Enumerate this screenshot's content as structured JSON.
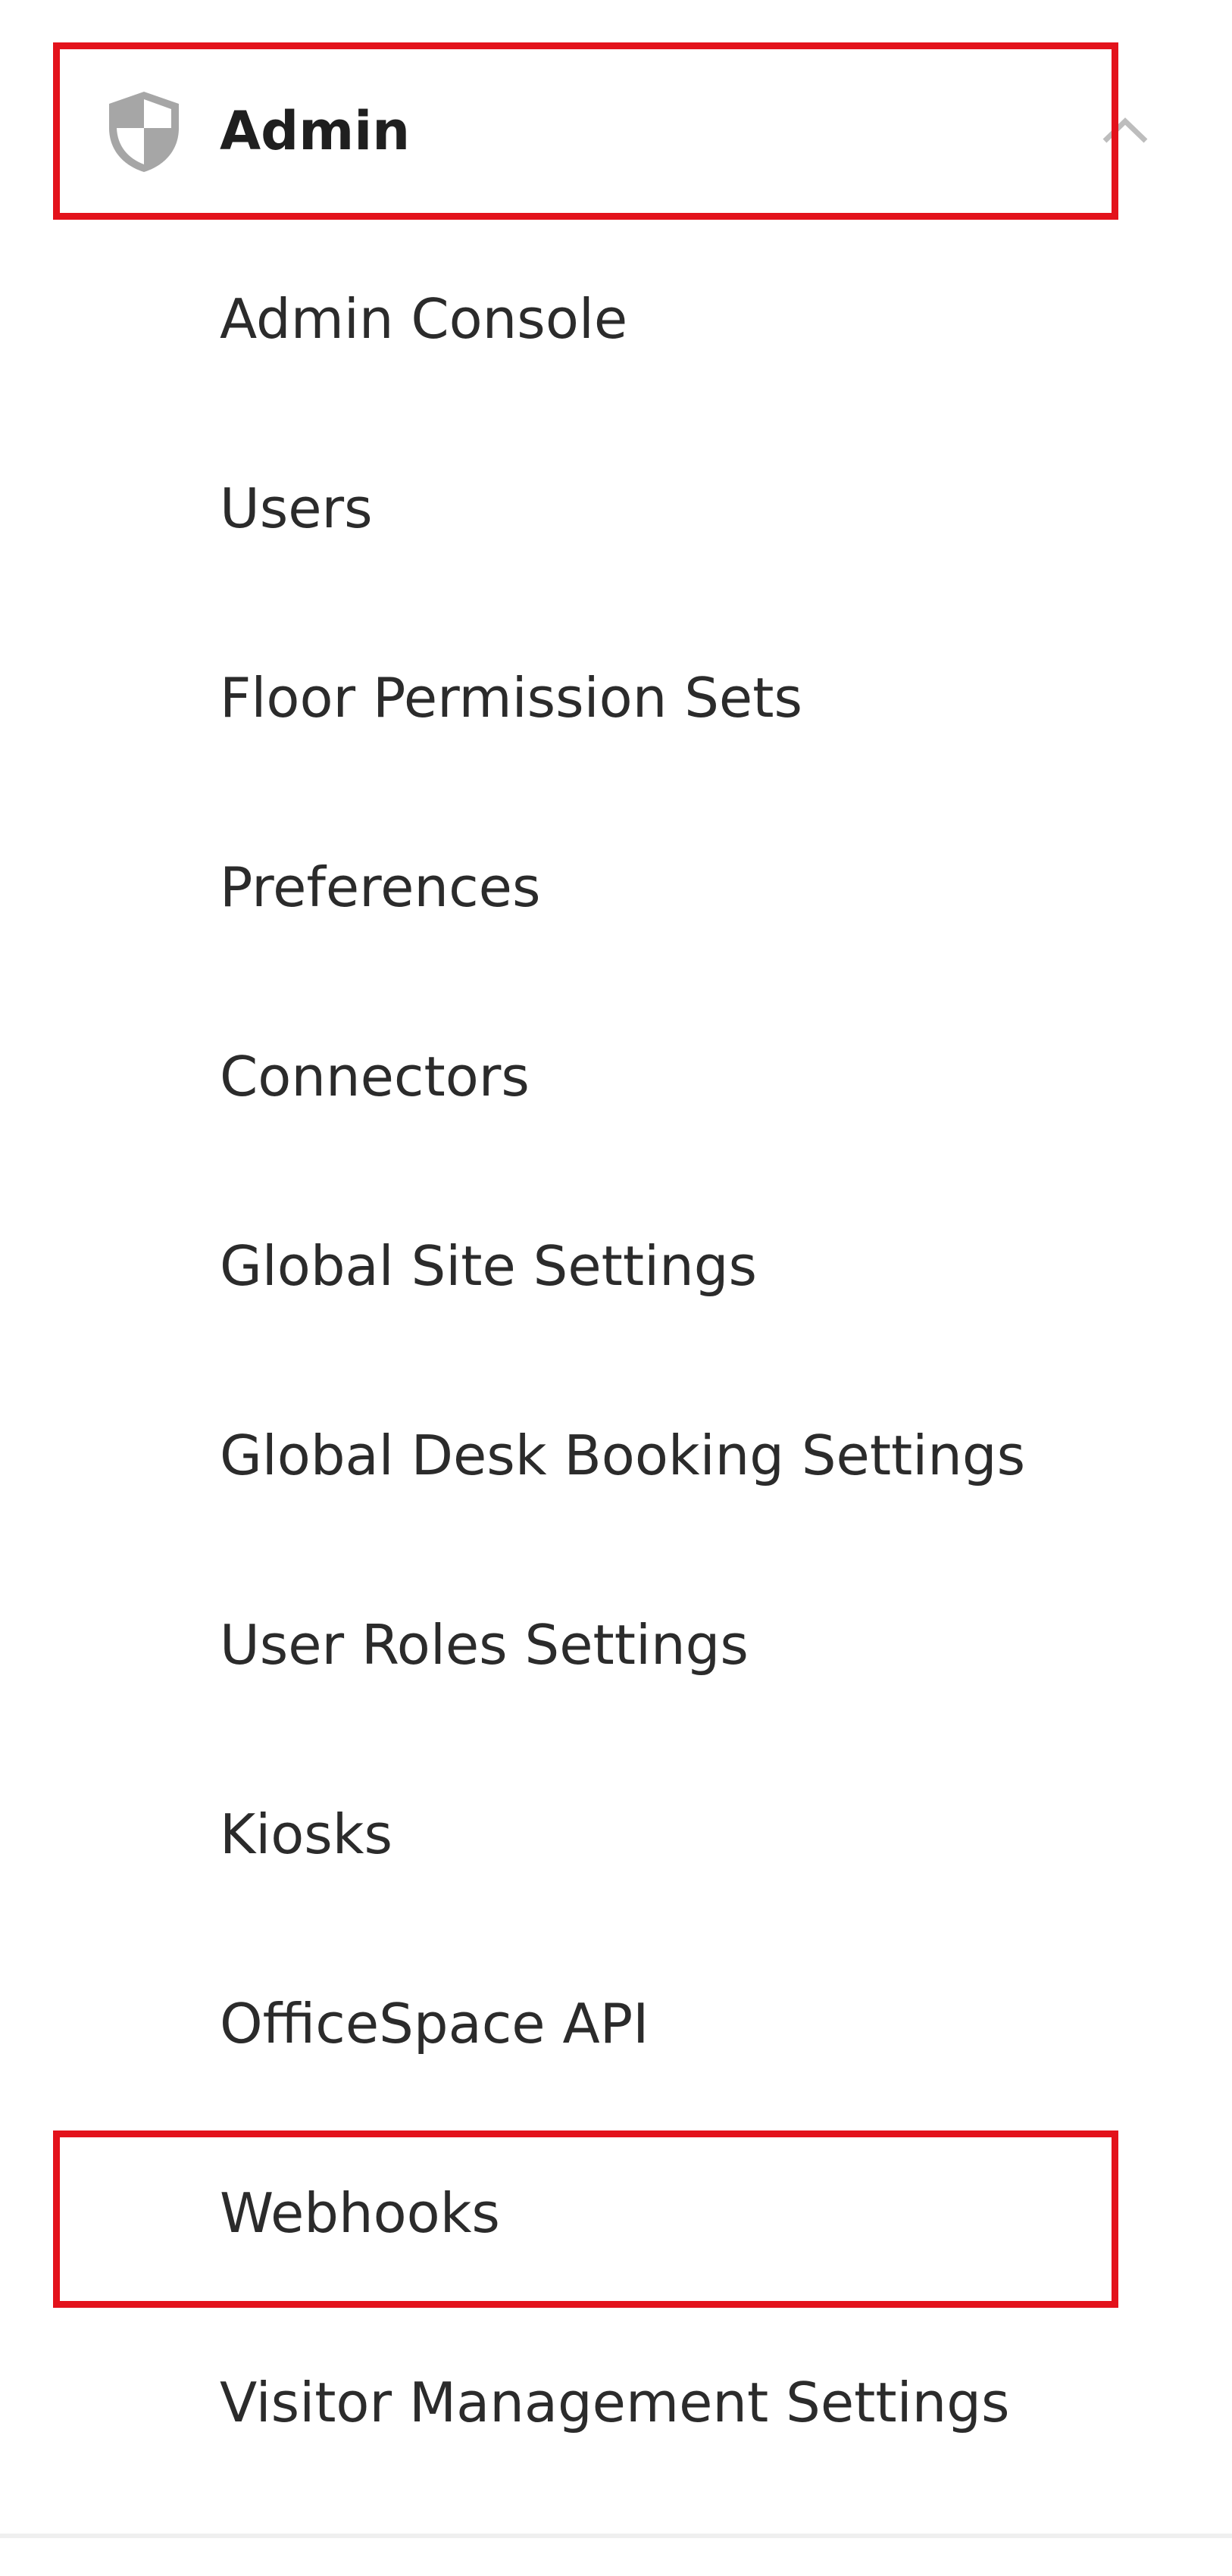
{
  "section": {
    "title": "Admin",
    "icon": "shield-icon",
    "chevron_icon": "chevron-up-icon",
    "expanded": true
  },
  "items": [
    {
      "label": "Admin Console"
    },
    {
      "label": "Users"
    },
    {
      "label": "Floor Permission Sets"
    },
    {
      "label": "Preferences"
    },
    {
      "label": "Connectors"
    },
    {
      "label": "Global Site Settings"
    },
    {
      "label": "Global Desk Booking Settings"
    },
    {
      "label": "User Roles Settings"
    },
    {
      "label": "Kiosks"
    },
    {
      "label": "OfficeSpace API"
    },
    {
      "label": "Webhooks"
    },
    {
      "label": "Visitor Management Settings"
    }
  ],
  "colors": {
    "highlight": "#e3121b",
    "icon": "#a6a6a6",
    "text": "#2b2b2b"
  }
}
